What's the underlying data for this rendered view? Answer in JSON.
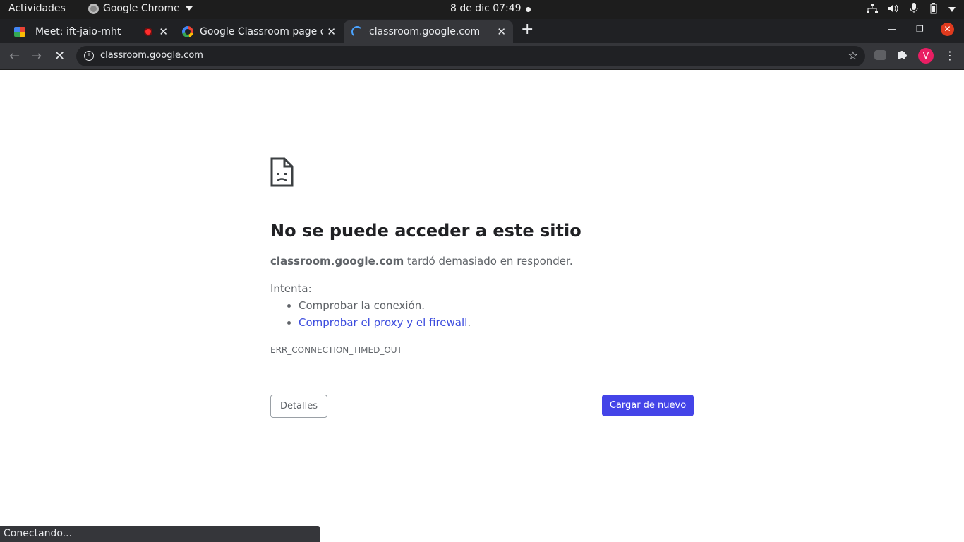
{
  "system_bar": {
    "activities": "Actividades",
    "app_name": "Google Chrome",
    "clock": "8 de dic  07:49"
  },
  "tabs": [
    {
      "label": "Meet: ift-jaio-mht",
      "icon": "google-meet-icon",
      "recording": true
    },
    {
      "label": "Google Classroom page d",
      "icon": "google-g-icon"
    },
    {
      "label": "classroom.google.com",
      "icon": "loading-spinner-icon",
      "active": true
    }
  ],
  "omnibox": {
    "url": "classroom.google.com"
  },
  "profile": {
    "initial": "V",
    "color": "#e91e63"
  },
  "error_page": {
    "title": "No se puede acceder a este sitio",
    "host": "classroom.google.com",
    "message_rest": " tardó demasiado en responder.",
    "try_label": "Intenta:",
    "suggestion_1": "Comprobar la conexión.",
    "suggestion_2_link": "Comprobar el proxy y el firewall",
    "suggestion_2_tail": ".",
    "error_code": "ERR_CONNECTION_TIMED_OUT",
    "details_button": "Detalles",
    "reload_button": "Cargar de nuevo"
  },
  "status_bar": "Conectando...",
  "colors": {
    "primary_button": "#4444e8",
    "link": "#3c4cde",
    "window_close": "#e03a1e"
  }
}
